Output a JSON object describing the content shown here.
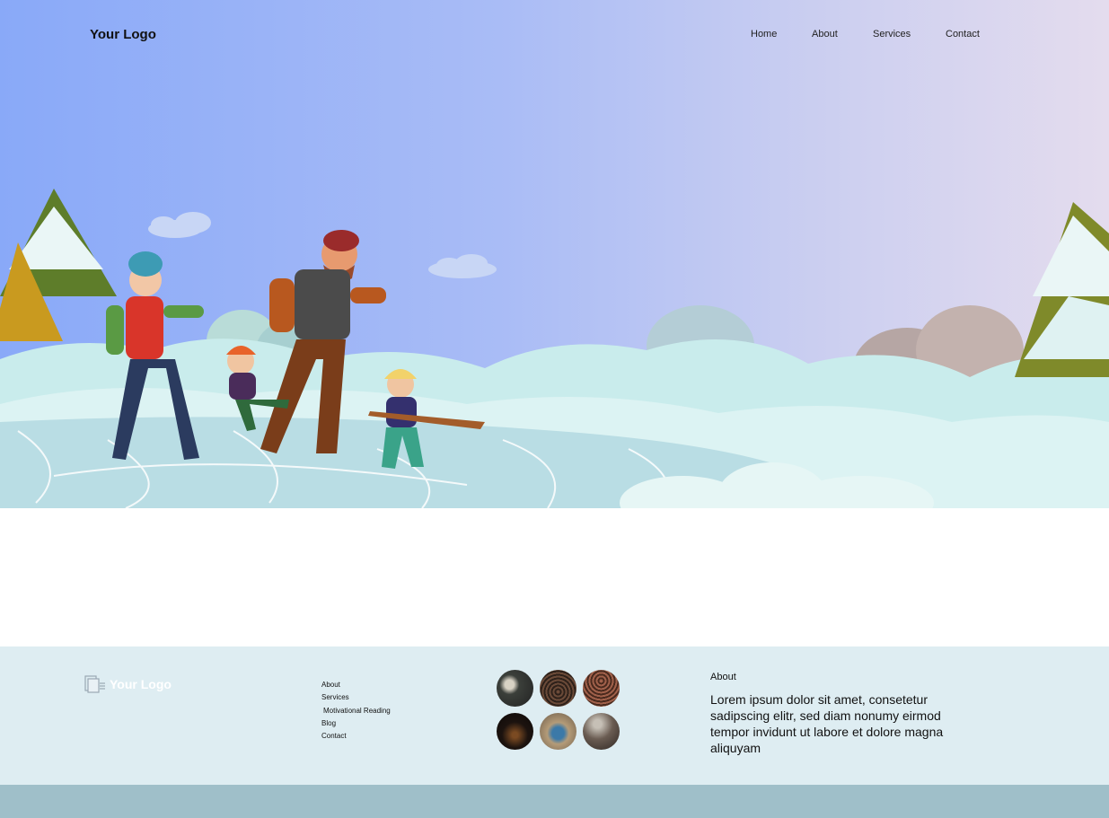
{
  "header": {
    "logo": "Your Logo",
    "nav": [
      "Home",
      "About",
      "Services",
      "Contact"
    ]
  },
  "hero": {
    "illustration": "family-ice-skating-winter-scene"
  },
  "footer": {
    "logo": "Your Logo",
    "logo_icon": "document-icon",
    "links": [
      "About",
      "Services",
      "Motivational Reading",
      "Blog",
      "Contact"
    ],
    "gallery": [
      {
        "icon": "photo-presentation",
        "color": "#3b3f3a"
      },
      {
        "icon": "photo-crowd",
        "color": "#3a2c24"
      },
      {
        "icon": "photo-audience",
        "color": "#5a3426"
      },
      {
        "icon": "photo-concert",
        "color": "#1c130f"
      },
      {
        "icon": "photo-person",
        "color": "#7a6a58"
      },
      {
        "icon": "photo-hall",
        "color": "#4a3f38"
      }
    ],
    "about": {
      "heading": "About",
      "text": "Lorem ipsum dolor sit amet, consetetur sadipscing elitr, sed diam nonumy eirmod tempor invidunt ut labore et dolore magna aliquyam"
    }
  },
  "colors": {
    "hero_gradient_start": "#89a9f8",
    "hero_gradient_end": "#e4dcee",
    "footer_bg": "#deedf2",
    "bottom_bar": "#9fbfc9"
  }
}
